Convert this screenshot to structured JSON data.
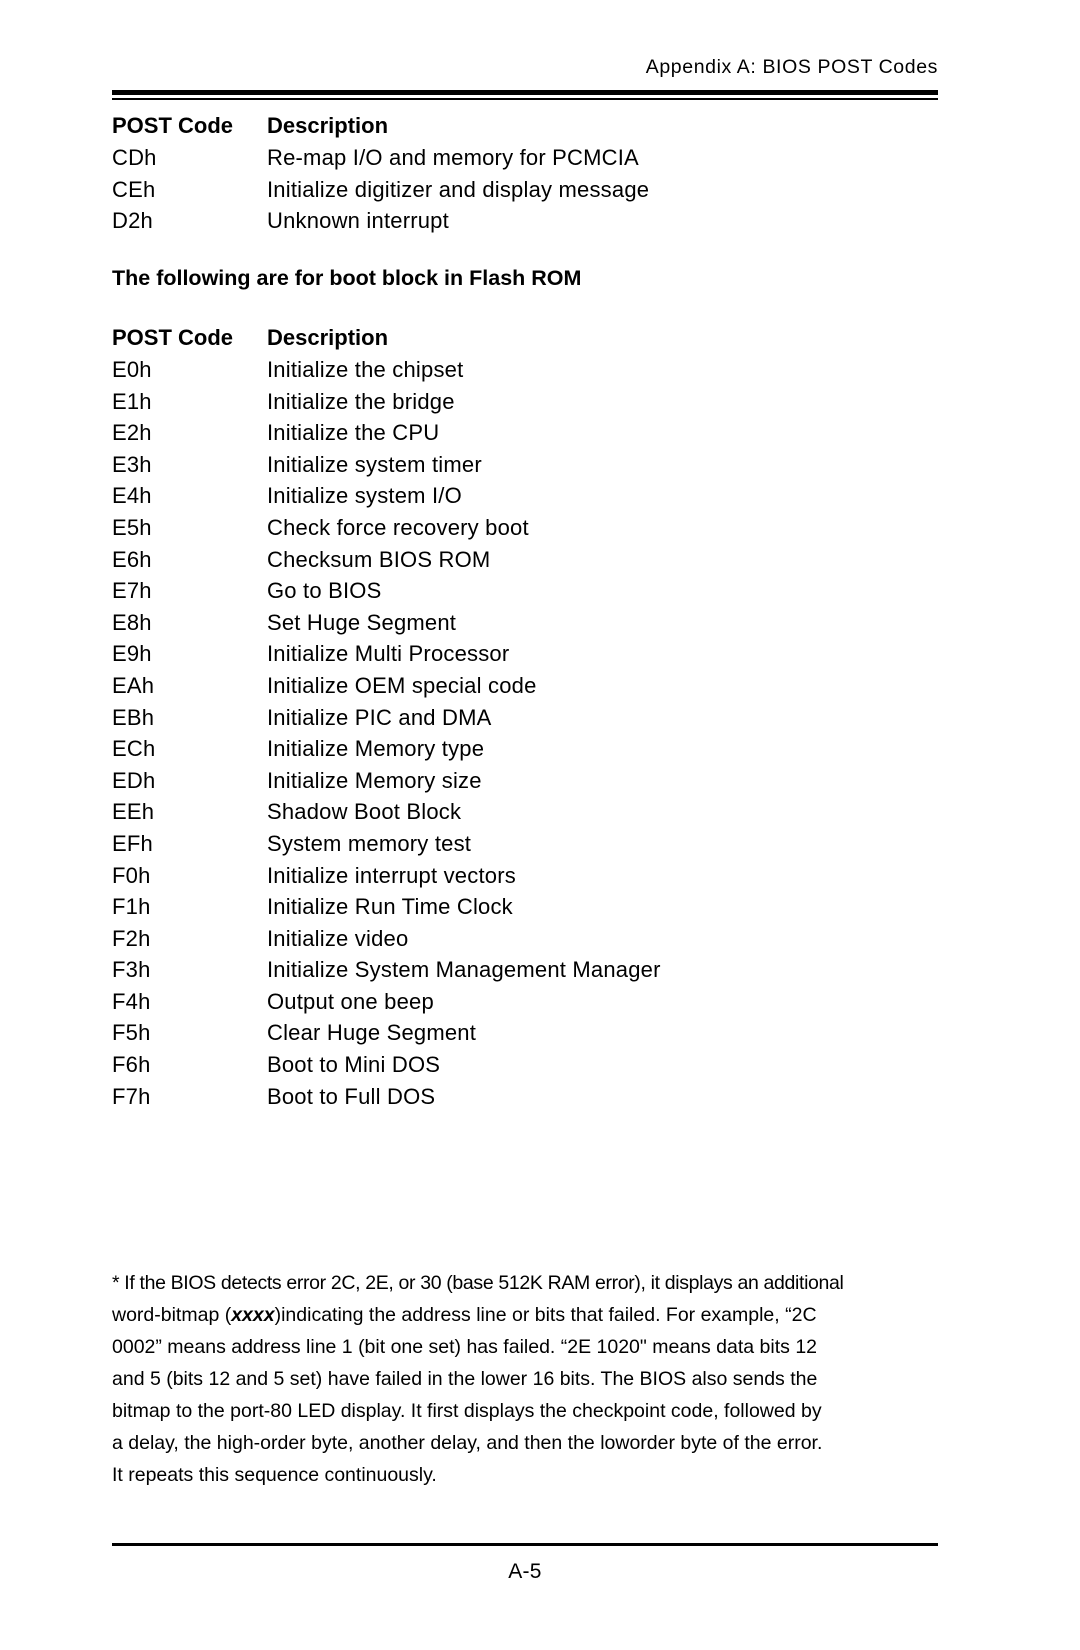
{
  "header": {
    "running_head": "Appendix A: BIOS POST Codes"
  },
  "table_one": {
    "columns": {
      "code": "POST Code",
      "description": "Description"
    },
    "rows": [
      {
        "code": "CDh",
        "description": "Re-map I/O and memory for PCMCIA"
      },
      {
        "code": "CEh",
        "description": "Initialize digitizer and display message"
      },
      {
        "code": "D2h",
        "description": "Unknown interrupt"
      }
    ]
  },
  "section_heading": "The following are for boot block in Flash ROM",
  "table_two": {
    "columns": {
      "code": "POST Code",
      "description": "Description"
    },
    "rows": [
      {
        "code": "E0h",
        "description": "Initialize the chipset"
      },
      {
        "code": "E1h",
        "description": "Initialize the bridge"
      },
      {
        "code": "E2h",
        "description": "Initialize the CPU"
      },
      {
        "code": "E3h",
        "description": "Initialize system timer"
      },
      {
        "code": "E4h",
        "description": "Initialize system I/O"
      },
      {
        "code": "E5h",
        "description": "Check force recovery boot"
      },
      {
        "code": "E6h",
        "description": "Checksum BIOS ROM"
      },
      {
        "code": "E7h",
        "description": "Go to BIOS"
      },
      {
        "code": "E8h",
        "description": "Set Huge Segment"
      },
      {
        "code": "E9h",
        "description": "Initialize Multi Processor"
      },
      {
        "code": "EAh",
        "description": "Initialize OEM special code"
      },
      {
        "code": "EBh",
        "description": "Initialize PIC and DMA"
      },
      {
        "code": "ECh",
        "description": "Initialize Memory type"
      },
      {
        "code": "EDh",
        "description": "Initialize Memory size"
      },
      {
        "code": "EEh",
        "description": "Shadow Boot Block"
      },
      {
        "code": "EFh",
        "description": "System memory test"
      },
      {
        "code": "F0h",
        "description": "Initialize interrupt vectors"
      },
      {
        "code": "F1h",
        "description": "Initialize Run Time Clock"
      },
      {
        "code": "F2h",
        "description": "Initialize video"
      },
      {
        "code": "F3h",
        "description": "Initialize System Management Manager"
      },
      {
        "code": "F4h",
        "description": "Output one beep"
      },
      {
        "code": "F5h",
        "description": "Clear Huge Segment"
      },
      {
        "code": "F6h",
        "description": "Boot to Mini DOS"
      },
      {
        "code": "F7h",
        "description": "Boot to Full DOS"
      }
    ]
  },
  "footnote": {
    "lines": [
      "* If the BIOS detects error 2C, 2E, or 30 (base 512K RAM error), it displays an additional",
      "indicating the address line or bits that failed.  For example, “2C",
      "0002” means address line 1 (bit one set) has failed.  “2E 1020\" means data bits 12",
      "and 5 (bits 12 and 5 set) have failed in the lower 16 bits.  The BIOS also sends the",
      "bitmap to the port-80 LED display.  It first displays the checkpoint code, followed by",
      "a delay, the high-order byte, another delay, and then the loworder byte of the error.",
      "It repeats this sequence continuously."
    ],
    "line2_prefix": "word-bitmap (",
    "line2_emphasis": "xxxx",
    "line2_suffix": ")"
  },
  "footer": {
    "page_number": "A-5"
  }
}
